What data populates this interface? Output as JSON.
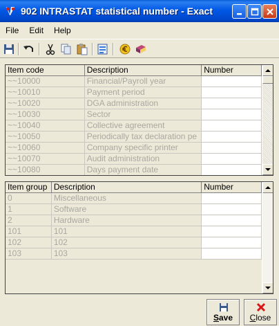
{
  "window": {
    "title": "902 INTRASTAT statistical number - Exact"
  },
  "menu": [
    {
      "label": "File"
    },
    {
      "label": "Edit"
    },
    {
      "label": "Help"
    }
  ],
  "toolbar": {
    "icons": [
      "save-icon",
      "undo-icon",
      "cut-icon",
      "copy-icon",
      "paste-icon",
      "browse-icon",
      "currency-icon",
      "book-icon"
    ]
  },
  "top_grid": {
    "headers": [
      "Item code",
      "Description",
      "Number"
    ],
    "rows": [
      {
        "code": "~~10000",
        "description": "Financial/Payroll year",
        "number": ""
      },
      {
        "code": "~~10010",
        "description": "Payment period",
        "number": ""
      },
      {
        "code": "~~10020",
        "description": "DGA administration",
        "number": ""
      },
      {
        "code": "~~10030",
        "description": "Sector",
        "number": ""
      },
      {
        "code": "~~10040",
        "description": "Collective agreement",
        "number": ""
      },
      {
        "code": "~~10050",
        "description": "Periodically tax declaration pe",
        "number": ""
      },
      {
        "code": "~~10060",
        "description": "Company specific printer",
        "number": ""
      },
      {
        "code": "~~10070",
        "description": "Audit administration",
        "number": ""
      },
      {
        "code": "~~10080",
        "description": "Days payment date",
        "number": ""
      }
    ]
  },
  "bottom_grid": {
    "headers": [
      "Item group",
      "Description",
      "Number"
    ],
    "rows": [
      {
        "code": "0",
        "description": "Miscellaneous",
        "number": ""
      },
      {
        "code": "1",
        "description": "Software",
        "number": ""
      },
      {
        "code": "2",
        "description": "Hardware",
        "number": ""
      },
      {
        "code": "101",
        "description": "101",
        "number": ""
      },
      {
        "code": "102",
        "description": "102",
        "number": ""
      },
      {
        "code": "103",
        "description": "103",
        "number": ""
      }
    ]
  },
  "footer": {
    "save_first": "S",
    "save_rest": "ave",
    "close_first": "C",
    "close_rest": "lose"
  },
  "colors": {
    "titlebar": "#0058e6",
    "window_bg": "#ece9d8",
    "disabled_text": "#a8a8a0",
    "close_icon": "#d81818"
  }
}
